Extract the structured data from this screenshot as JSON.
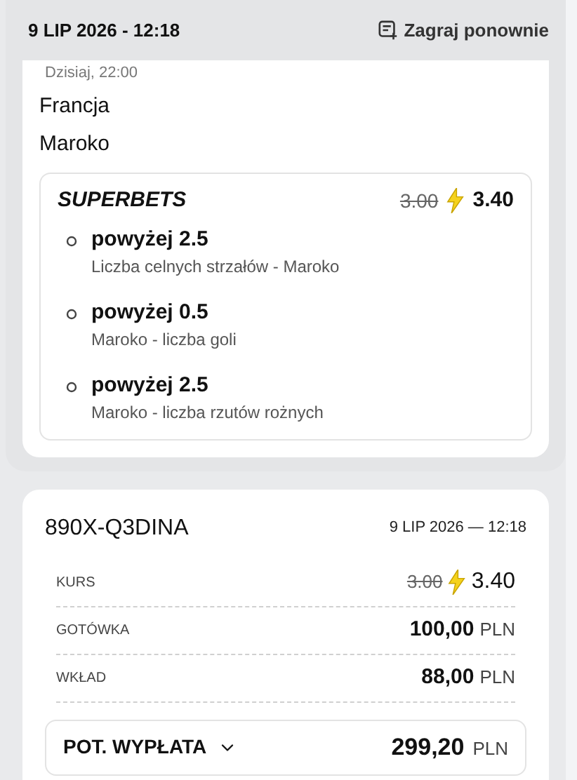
{
  "header": {
    "date": "9 LIP 2026 - 12:18",
    "replay_button": "Zagraj ponownie"
  },
  "event": {
    "time": "Dzisiaj, 22:00",
    "teams": [
      "Francja",
      "Maroko"
    ]
  },
  "superbet": {
    "title": "SUPERBETS",
    "old_odds": "3.00",
    "new_odds": "3.40",
    "selections": [
      {
        "pick": "powyżej 2.5",
        "market": "Liczba celnych strzałów - Maroko"
      },
      {
        "pick": "powyżej 0.5",
        "market": "Maroko - liczba goli"
      },
      {
        "pick": "powyżej 2.5",
        "market": "Maroko - liczba rzutów rożnych"
      }
    ]
  },
  "ticket": {
    "id": "890X-Q3DINA",
    "date": "9 LIP 2026 — 12:18",
    "rows": [
      {
        "kind": "odds",
        "label": "KURS",
        "old_odds": "3.00",
        "new_odds": "3.40"
      },
      {
        "kind": "amount",
        "label": "GOTÓWKA",
        "value": "100,00",
        "currency": "PLN"
      },
      {
        "kind": "amount",
        "label": "WKŁAD",
        "value": "88,00",
        "currency": "PLN"
      }
    ],
    "payout": {
      "label": "POT. WYPŁATA",
      "expanded": false,
      "value": "299,20",
      "currency": "PLN"
    }
  }
}
